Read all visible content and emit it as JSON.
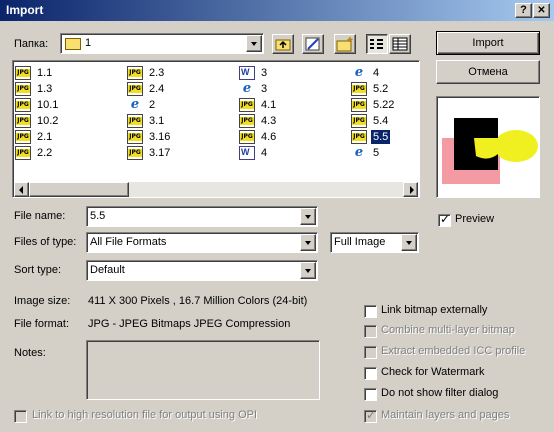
{
  "window": {
    "title": "Import",
    "help_glyph": "?",
    "close_glyph": "✕"
  },
  "look_in": {
    "label": "Папка:",
    "value": "1"
  },
  "buttons": {
    "import": "Import",
    "cancel": "Отмена"
  },
  "files": [
    {
      "name": "1.1",
      "type": "jpg"
    },
    {
      "name": "1.3",
      "type": "jpg"
    },
    {
      "name": "10.1",
      "type": "jpg"
    },
    {
      "name": "10.2",
      "type": "jpg"
    },
    {
      "name": "2.1",
      "type": "jpg"
    },
    {
      "name": "2.2",
      "type": "jpg"
    },
    {
      "name": "2.3",
      "type": "jpg"
    },
    {
      "name": "2.4",
      "type": "jpg"
    },
    {
      "name": "2",
      "type": "html"
    },
    {
      "name": "3.1",
      "type": "jpg"
    },
    {
      "name": "3.16",
      "type": "jpg"
    },
    {
      "name": "3.17",
      "type": "jpg"
    },
    {
      "name": "3",
      "type": "doc"
    },
    {
      "name": "3",
      "type": "html"
    },
    {
      "name": "4.1",
      "type": "jpg"
    },
    {
      "name": "4.3",
      "type": "jpg"
    },
    {
      "name": "4.6",
      "type": "jpg"
    },
    {
      "name": "4",
      "type": "doc"
    },
    {
      "name": "4",
      "type": "html"
    },
    {
      "name": "5.2",
      "type": "jpg"
    },
    {
      "name": "5.22",
      "type": "jpg"
    },
    {
      "name": "5.4",
      "type": "jpg"
    },
    {
      "name": "5.5",
      "type": "jpg",
      "selected": true
    },
    {
      "name": "5",
      "type": "html"
    }
  ],
  "fields": {
    "file_name_label": "File name:",
    "file_name_value": "5.5",
    "file_type_label": "Files of type:",
    "file_type_value": "All File Formats",
    "full_image_value": "Full Image",
    "sort_type_label": "Sort type:",
    "sort_type_value": "Default"
  },
  "info": {
    "image_size_label": "Image size:",
    "image_size_value": "411 X 300 Pixels , 16.7 Million Colors (24-bit)",
    "file_format_label": "File format:",
    "file_format_value": "JPG - JPEG Bitmaps JPEG Compression",
    "notes_label": "Notes:"
  },
  "preview_label": "Preview",
  "preview_checked": true,
  "options": [
    {
      "label": "Link bitmap externally",
      "checked": false,
      "disabled": false
    },
    {
      "label": "Combine multi-layer bitmap",
      "checked": false,
      "disabled": true
    },
    {
      "label": "Extract embedded ICC profile",
      "checked": false,
      "disabled": true
    },
    {
      "label": "Check for Watermark",
      "checked": false,
      "disabled": false
    },
    {
      "label": "Do not show filter dialog",
      "checked": false,
      "disabled": false
    },
    {
      "label": "Maintain layers and pages",
      "checked": true,
      "disabled": true
    }
  ],
  "opi_link_label": "Link to high resolution file for output using OPI",
  "colors": {
    "title_start": "#0a246a",
    "title_end": "#a6caf0",
    "selection": "#0a246a",
    "face": "#d4d0c8"
  }
}
